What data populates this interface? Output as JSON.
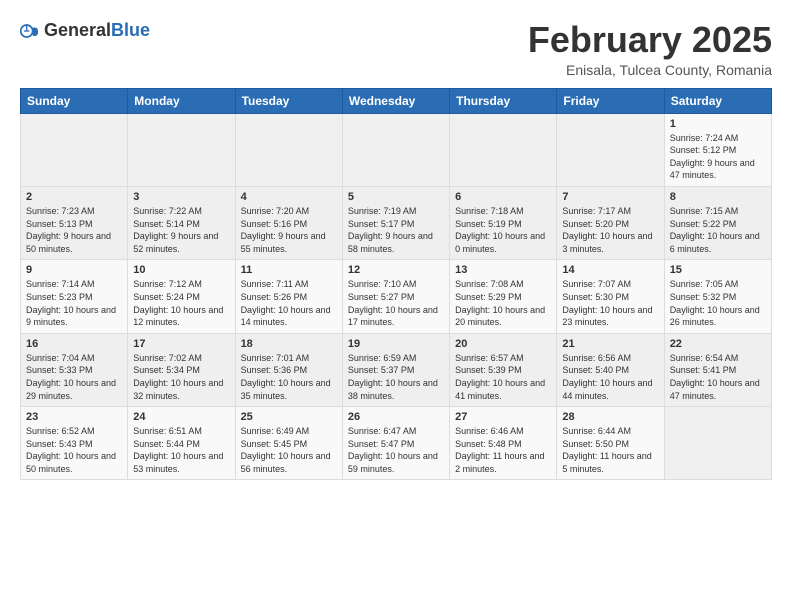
{
  "header": {
    "logo_general": "General",
    "logo_blue": "Blue",
    "title": "February 2025",
    "subtitle": "Enisala, Tulcea County, Romania"
  },
  "weekdays": [
    "Sunday",
    "Monday",
    "Tuesday",
    "Wednesday",
    "Thursday",
    "Friday",
    "Saturday"
  ],
  "weeks": [
    [
      {
        "day": "",
        "info": ""
      },
      {
        "day": "",
        "info": ""
      },
      {
        "day": "",
        "info": ""
      },
      {
        "day": "",
        "info": ""
      },
      {
        "day": "",
        "info": ""
      },
      {
        "day": "",
        "info": ""
      },
      {
        "day": "1",
        "info": "Sunrise: 7:24 AM\nSunset: 5:12 PM\nDaylight: 9 hours and 47 minutes."
      }
    ],
    [
      {
        "day": "2",
        "info": "Sunrise: 7:23 AM\nSunset: 5:13 PM\nDaylight: 9 hours and 50 minutes."
      },
      {
        "day": "3",
        "info": "Sunrise: 7:22 AM\nSunset: 5:14 PM\nDaylight: 9 hours and 52 minutes."
      },
      {
        "day": "4",
        "info": "Sunrise: 7:20 AM\nSunset: 5:16 PM\nDaylight: 9 hours and 55 minutes."
      },
      {
        "day": "5",
        "info": "Sunrise: 7:19 AM\nSunset: 5:17 PM\nDaylight: 9 hours and 58 minutes."
      },
      {
        "day": "6",
        "info": "Sunrise: 7:18 AM\nSunset: 5:19 PM\nDaylight: 10 hours and 0 minutes."
      },
      {
        "day": "7",
        "info": "Sunrise: 7:17 AM\nSunset: 5:20 PM\nDaylight: 10 hours and 3 minutes."
      },
      {
        "day": "8",
        "info": "Sunrise: 7:15 AM\nSunset: 5:22 PM\nDaylight: 10 hours and 6 minutes."
      }
    ],
    [
      {
        "day": "9",
        "info": "Sunrise: 7:14 AM\nSunset: 5:23 PM\nDaylight: 10 hours and 9 minutes."
      },
      {
        "day": "10",
        "info": "Sunrise: 7:12 AM\nSunset: 5:24 PM\nDaylight: 10 hours and 12 minutes."
      },
      {
        "day": "11",
        "info": "Sunrise: 7:11 AM\nSunset: 5:26 PM\nDaylight: 10 hours and 14 minutes."
      },
      {
        "day": "12",
        "info": "Sunrise: 7:10 AM\nSunset: 5:27 PM\nDaylight: 10 hours and 17 minutes."
      },
      {
        "day": "13",
        "info": "Sunrise: 7:08 AM\nSunset: 5:29 PM\nDaylight: 10 hours and 20 minutes."
      },
      {
        "day": "14",
        "info": "Sunrise: 7:07 AM\nSunset: 5:30 PM\nDaylight: 10 hours and 23 minutes."
      },
      {
        "day": "15",
        "info": "Sunrise: 7:05 AM\nSunset: 5:32 PM\nDaylight: 10 hours and 26 minutes."
      }
    ],
    [
      {
        "day": "16",
        "info": "Sunrise: 7:04 AM\nSunset: 5:33 PM\nDaylight: 10 hours and 29 minutes."
      },
      {
        "day": "17",
        "info": "Sunrise: 7:02 AM\nSunset: 5:34 PM\nDaylight: 10 hours and 32 minutes."
      },
      {
        "day": "18",
        "info": "Sunrise: 7:01 AM\nSunset: 5:36 PM\nDaylight: 10 hours and 35 minutes."
      },
      {
        "day": "19",
        "info": "Sunrise: 6:59 AM\nSunset: 5:37 PM\nDaylight: 10 hours and 38 minutes."
      },
      {
        "day": "20",
        "info": "Sunrise: 6:57 AM\nSunset: 5:39 PM\nDaylight: 10 hours and 41 minutes."
      },
      {
        "day": "21",
        "info": "Sunrise: 6:56 AM\nSunset: 5:40 PM\nDaylight: 10 hours and 44 minutes."
      },
      {
        "day": "22",
        "info": "Sunrise: 6:54 AM\nSunset: 5:41 PM\nDaylight: 10 hours and 47 minutes."
      }
    ],
    [
      {
        "day": "23",
        "info": "Sunrise: 6:52 AM\nSunset: 5:43 PM\nDaylight: 10 hours and 50 minutes."
      },
      {
        "day": "24",
        "info": "Sunrise: 6:51 AM\nSunset: 5:44 PM\nDaylight: 10 hours and 53 minutes."
      },
      {
        "day": "25",
        "info": "Sunrise: 6:49 AM\nSunset: 5:45 PM\nDaylight: 10 hours and 56 minutes."
      },
      {
        "day": "26",
        "info": "Sunrise: 6:47 AM\nSunset: 5:47 PM\nDaylight: 10 hours and 59 minutes."
      },
      {
        "day": "27",
        "info": "Sunrise: 6:46 AM\nSunset: 5:48 PM\nDaylight: 11 hours and 2 minutes."
      },
      {
        "day": "28",
        "info": "Sunrise: 6:44 AM\nSunset: 5:50 PM\nDaylight: 11 hours and 5 minutes."
      },
      {
        "day": "",
        "info": ""
      }
    ]
  ]
}
